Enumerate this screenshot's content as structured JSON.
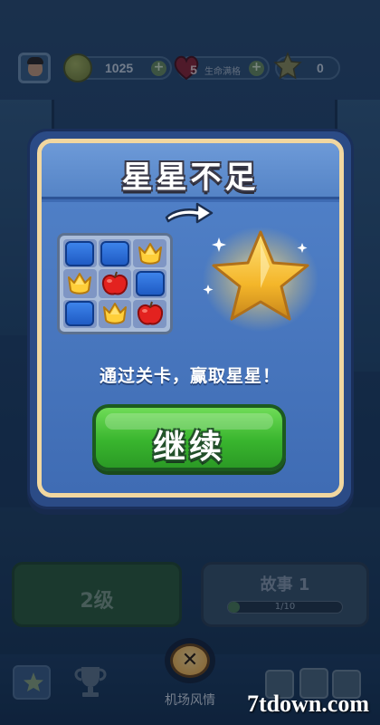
{
  "hud": {
    "coins": "1025",
    "lives": "5",
    "lives_label": "生命满格",
    "stars": "0",
    "icons": {
      "avatar": "player-avatar",
      "coin": "coin-icon",
      "heart": "heart-icon",
      "star": "star-icon",
      "plus": "plus-icon"
    }
  },
  "dialog": {
    "title": "星星不足",
    "message": "通过关卡，赢取星星！",
    "continue_label": "继续",
    "board": [
      [
        "box",
        "box",
        "tulip"
      ],
      [
        "tulip",
        "apple",
        "box"
      ],
      [
        "box",
        "tulip",
        "apple"
      ]
    ]
  },
  "scene": {
    "level_label": "2级",
    "story_label": "故事 1",
    "story_progress_text": "1/10",
    "story_progress": 0.1,
    "close_label": "✕",
    "location_label": "机场风情"
  },
  "watermark": "7tdown.com",
  "colors": {
    "dialog_border": "#f1d7a0",
    "dialog_bg": "#3e6bb3",
    "continue_green": "#39b52e",
    "star_gold": "#f4b62a",
    "close_orange": "#f1a93a"
  }
}
